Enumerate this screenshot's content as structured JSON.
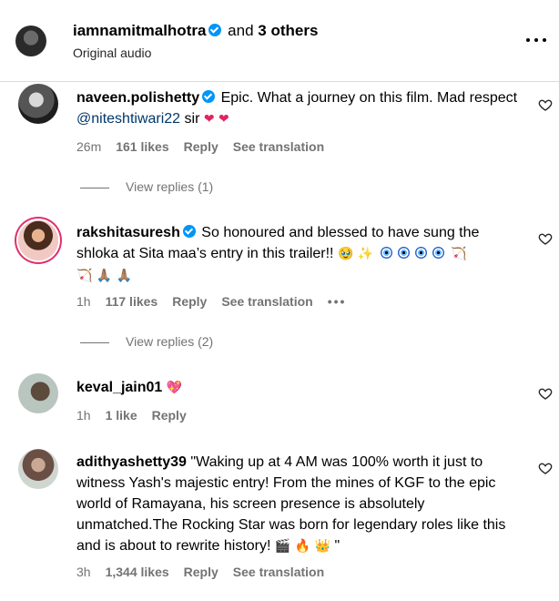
{
  "header": {
    "username": "iamnamitmalhotra",
    "and_text": "and",
    "others_text": "3 others",
    "audio_label": "Original audio",
    "more_icon": "more-horizontal-icon"
  },
  "comments": [
    {
      "username": "naveen.polishetty",
      "verified": true,
      "text_before": "Epic. What a journey on this film. Mad respect ",
      "mention": "@niteshtiwari22",
      "text_after": " sir",
      "emojis": "❤ ❤",
      "time": "26m",
      "likes": "161 likes",
      "reply": "Reply",
      "translate": "See translation",
      "view_replies": "View replies (1)"
    },
    {
      "username": "rakshitasuresh",
      "verified": true,
      "text": "So honoured and blessed to have sung the shloka at Sita maa’s entry in this trailer!!",
      "emojis_line1": "🥹 ✨",
      "emojis_line1_end": "🏹",
      "emojis_line2": "🏹 🙏🏽 🙏🏽",
      "time": "1h",
      "likes": "117 likes",
      "reply": "Reply",
      "translate": "See translation",
      "more": "•••",
      "view_replies": "View replies (2)"
    },
    {
      "username": "keval_jain01",
      "emoji": "💖",
      "time": "1h",
      "likes": "1 like",
      "reply": "Reply"
    },
    {
      "username": "adithyashetty39",
      "text": "\"Waking up at 4 AM was 100% worth it just to witness Yash's majestic entry! From the mines of KGF to the epic world of Ramayana, his screen presence is absolutely unmatched.The Rocking Star was born for legendary roles like this and is about to rewrite history!",
      "emojis": "🎬 🔥 👑",
      "quote_end": " \"",
      "time": "3h",
      "likes": "1,344 likes",
      "reply": "Reply",
      "translate": "See translation"
    }
  ],
  "colors": {
    "link": "#00376b",
    "muted": "#737373",
    "verified": "#0095f6",
    "heart": "#e0245e"
  }
}
